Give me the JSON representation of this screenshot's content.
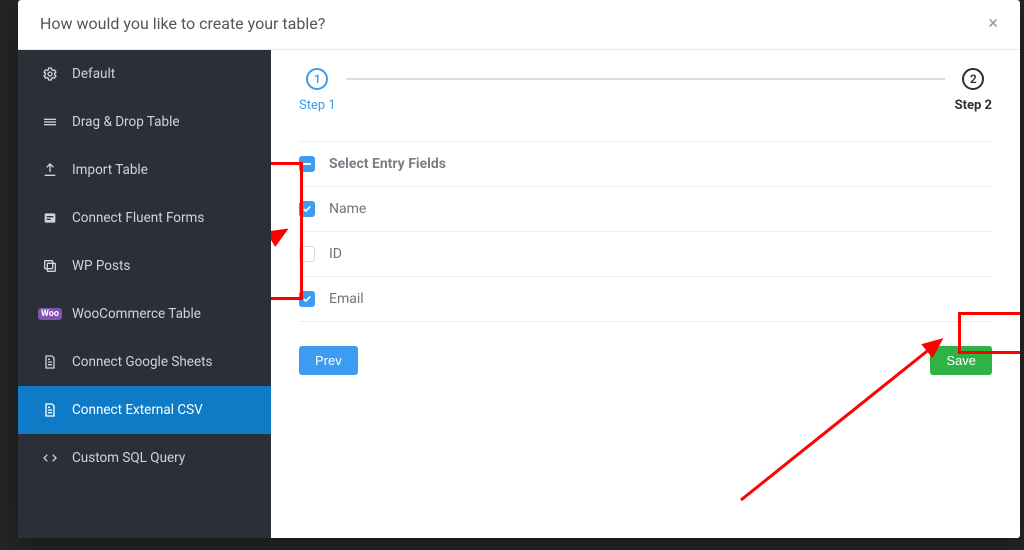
{
  "modal": {
    "title": "How would you like to create your table?"
  },
  "sidebar": {
    "items": [
      {
        "icon": "gear",
        "label": "Default"
      },
      {
        "icon": "grid",
        "label": "Drag & Drop Table"
      },
      {
        "icon": "upload",
        "label": "Import Table"
      },
      {
        "icon": "form",
        "label": "Connect Fluent Forms"
      },
      {
        "icon": "copy",
        "label": "WP Posts"
      },
      {
        "icon": "woo",
        "label": "WooCommerce Table"
      },
      {
        "icon": "sheet",
        "label": "Connect Google Sheets"
      },
      {
        "icon": "sheet",
        "label": "Connect External CSV",
        "active": true
      },
      {
        "icon": "code",
        "label": "Custom SQL Query"
      }
    ]
  },
  "stepper": {
    "steps": [
      {
        "num": "1",
        "label": "Step 1",
        "state": "active"
      },
      {
        "num": "2",
        "label": "Step 2",
        "state": "current"
      }
    ]
  },
  "fields": {
    "header": "Select Entry Fields",
    "rows": [
      {
        "label": "Name",
        "checked": true
      },
      {
        "label": "ID",
        "checked": false
      },
      {
        "label": "Email",
        "checked": true
      }
    ]
  },
  "buttons": {
    "prev": "Prev",
    "save": "Save"
  }
}
